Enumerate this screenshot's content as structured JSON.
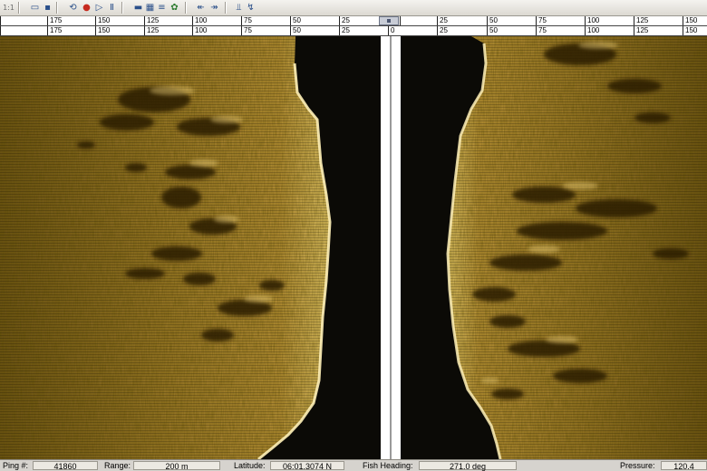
{
  "toolbar": {
    "icons": [
      "zoom-icon",
      "open-folder-icon",
      "save-icon",
      "record-icon",
      "stop-icon",
      "play-icon",
      "pause-icon",
      "display-icon",
      "grid-icon",
      "list-icon",
      "settings-icon",
      "step-back-icon",
      "step-forward-icon",
      "chart-icon",
      "wave-icon"
    ],
    "zoom_label": "1:1"
  },
  "scale": {
    "port_ticks": [
      "175",
      "150",
      "125",
      "100",
      "75",
      "50",
      "25"
    ],
    "starboard_ticks": [
      "25",
      "50",
      "75",
      "100",
      "125",
      "150"
    ],
    "center_tick": "0",
    "top_row_end": "17",
    "bottom_row_end": "17"
  },
  "status": {
    "ping_label": "Ping #:",
    "ping_value": "41860",
    "range_label": "Range:",
    "range_value": "200 m",
    "latitude_label": "Latitude:",
    "latitude_value": "06:01.3074 N",
    "heading_label": "Fish Heading:",
    "heading_value": "271.0 deg",
    "pressure_label": "Pressure:",
    "pressure_value": "120.4"
  },
  "colors": {
    "sonar_bright": "#e8c86a",
    "sonar_mid": "#a8842e",
    "sonar_dark": "#3a2a0c",
    "water": "#0b0a06"
  }
}
